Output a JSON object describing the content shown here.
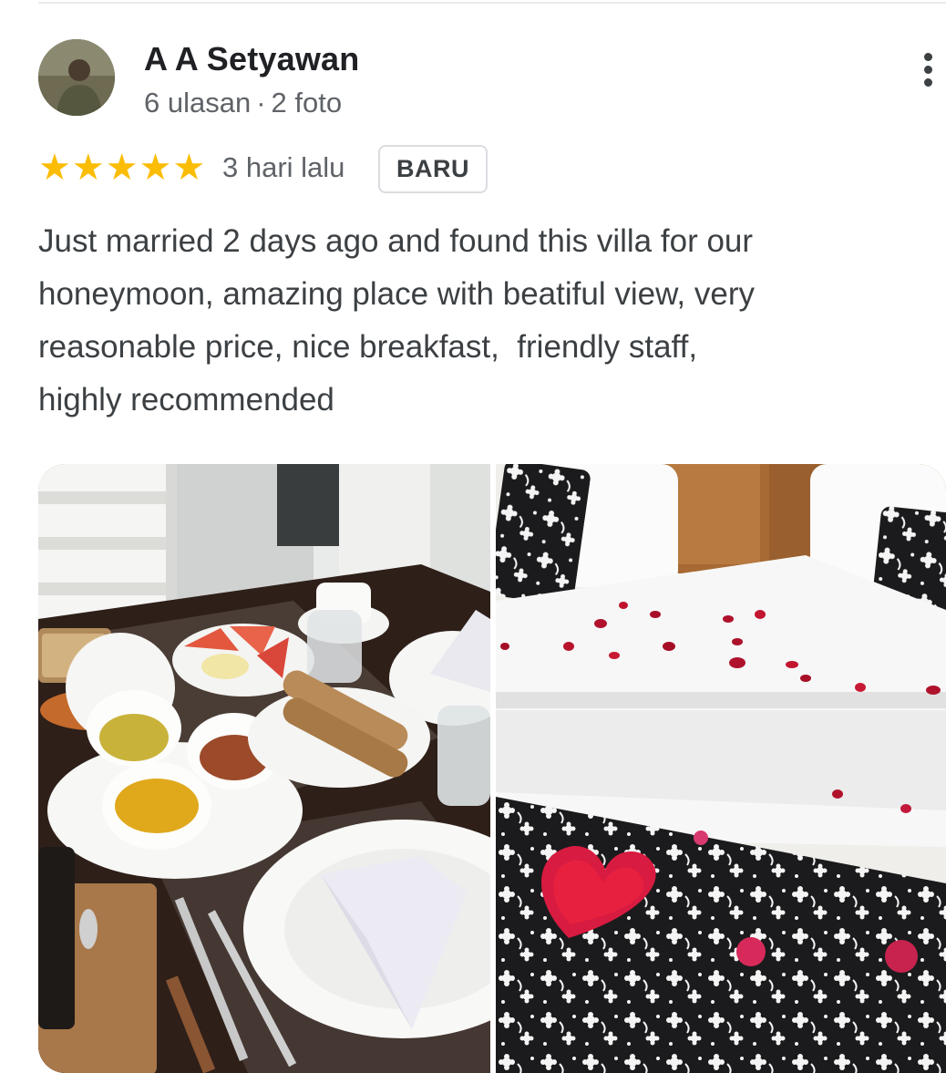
{
  "review": {
    "author": "A A Setyawan",
    "review_count": "6 ulasan",
    "separator": "·",
    "photo_count": "2 foto",
    "rating": 5,
    "stars": [
      "★",
      "★",
      "★",
      "★",
      "★"
    ],
    "time_ago": "3 hari lalu",
    "badge": "BARU",
    "text": "Just married 2 days ago and found this villa for our\nhoneymoon, amazing place with beatiful view, very\nreasonable price, nice breakfast,  friendly staff,\nhighly recommended"
  },
  "icons": {
    "menu": "more-vert-icon",
    "star": "star-icon"
  },
  "colors": {
    "star": "#fbbc04",
    "secondary_text": "#5f6368",
    "primary_text": "#202124"
  }
}
